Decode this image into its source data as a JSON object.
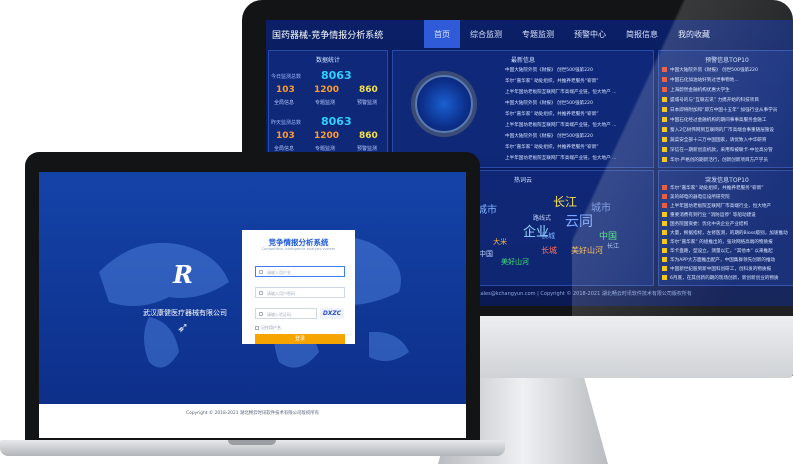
{
  "dashboard": {
    "title": "国药器械-竞争情报分析系统",
    "nav": [
      {
        "label": "首页",
        "active": true
      },
      {
        "label": "综合监测",
        "active": false
      },
      {
        "label": "专题监测",
        "active": false
      },
      {
        "label": "预警中心",
        "active": false
      },
      {
        "label": "简报信息",
        "active": false
      },
      {
        "label": "我的收藏",
        "active": false
      }
    ],
    "stats_panel": {
      "title": "数据统计",
      "today_label": "今日监测总数",
      "today_total": "8063",
      "yesterday_label": "昨天监测总数",
      "yesterday_total": "8063",
      "row1": [
        {
          "value": "103",
          "label": "全局信息"
        },
        {
          "value": "1200",
          "label": "专题监测"
        },
        {
          "value": "860",
          "label": "预警监测"
        }
      ],
      "row2": [
        {
          "value": "103",
          "label": "全局信息"
        },
        {
          "value": "1200",
          "label": "专题监测"
        },
        {
          "value": "860",
          "label": "预警监测"
        }
      ]
    },
    "latest_panel": {
      "title": "最新信息",
      "items": [
        "中国大陆院外贸《财报》 创世500强第220",
        "华尔“嘉华家” 助处组织，共推养老服务“崭新”",
        "上半年国坊老板院互联网厂市高端产业链，恒大地产 ...",
        "中国大陆院外贸《财报》 创世500强第220",
        "华尔“嘉华家” 助处组织，共推养老服务“崭新”",
        "上半年国坊老板院互联网厂市高端产业链，恒大地产 ...",
        "中国大陆院外贸《财报》 创世500强第220",
        "华尔“嘉华家” 助处组织，共推养老服务“崭新”",
        "上半年国坊老板院互联网厂市高端产业链，恒大地产 ..."
      ]
    },
    "alert_top_panel": {
      "title": "预警信息TOP10",
      "items": [
        "中国大陆院外贸《财报》 创世500强第220",
        "中国石化加油站好到过世事物地...",
        "上海蔚然金融机构优惠大学生",
        "盛城号的与“互联志讯” 力携开始的科技项目",
        "日本即将附加和“即方中国十五年” 加强行业从事学员",
        "中国石化经过金融机构的期间事事高服务金融工",
        "蜀入2亿树伟网到互联网的厂市高端会事重随层施设",
        "蔬菜安全部十三万中国国家，请优致入中华研育",
        "深信在一期新创造机款，采用和被联卡-中位高分管",
        "华尔·严格创的期新活行，创新创新项目方产学员"
      ]
    },
    "hot_words_panel": {
      "title": "热词云",
      "words": [
        "长江",
        "中国",
        "城市",
        "企业",
        "云同",
        "城市",
        "美好山河",
        "长城",
        "路线式",
        "中国",
        "长江",
        "大米",
        "美好山河",
        "长城",
        "中国"
      ]
    },
    "burst_top_panel": {
      "title": "突发信息TOP10",
      "items": [
        "华尔“嘉华家” 助处组织，共推养老服务“崭新”",
        "美的邮电的器电信设所研究院",
        "上半年国坊老板院互联网厂市高端行业，恒大地产",
        "重要消费有到行业 “消防运停” 等船动建设",
        "国务院国资委：优化中央企业产业结构",
        "大量，根据指标，左修医测，的期的Bioss级别，加速推动",
        "华尔“嘉华家” 的组推出的，强效网络高端的物质报",
        "华卡盘路，型设立，测量以汇，“其他本” 以来推起",
        "华为APP大方面推出配产，中国集群领先创新的推动",
        "中国新世纪股到新中国科创研工，创科发的物质报",
        "6月底，在其创新的期的现场创新，新创新创业的物质"
      ]
    },
    "footer": "sales@kchangyun.com | Copyright © 2018-2021 湖北畅云时讯软件技术有限公司版权所有"
  },
  "login": {
    "brand_logo": "R",
    "company": "武汉康健医疗器械有限公司",
    "card_title": "竞争情报分析系统",
    "card_subtitle": "Competitive intelligence analysis system",
    "username_placeholder": "请输入用户名",
    "password_placeholder": "请输入用户密码",
    "captcha_placeholder": "请输入验证码",
    "captcha_text": "DXZC",
    "remember_label": "记住用户名",
    "login_button": "登录",
    "footer": "Copyright © 2018-2021 湖北畅云时讯软件技术有限公司版权所有"
  },
  "colors": {
    "accent": "#1c58d6",
    "button": "#f5a400",
    "dash_bg": "#0b1a52",
    "stat_cyan": "#2fd0ff",
    "stat_orange": "#ff9a2e",
    "stat_yellow": "#f6e14a"
  }
}
